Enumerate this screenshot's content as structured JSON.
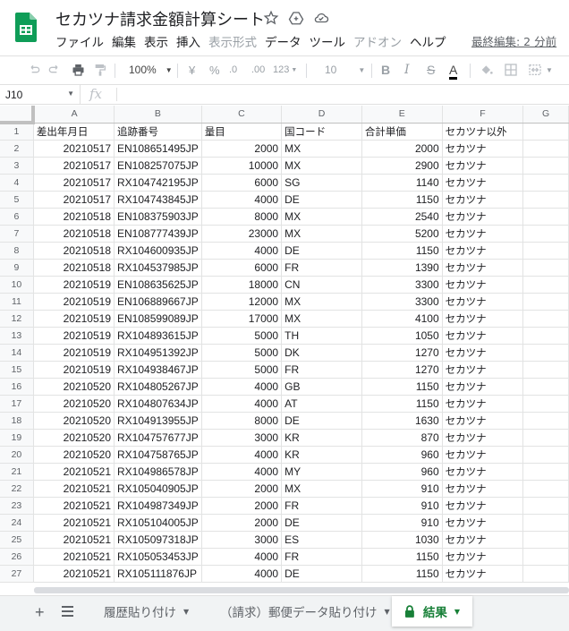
{
  "app": {
    "title": "セカツナ請求金額計算シート",
    "last_edit": "最終編集: 2 分前",
    "brand_color": "#0f9d58"
  },
  "menu": {
    "items": [
      {
        "label": "ファイル",
        "enabled": true
      },
      {
        "label": "編集",
        "enabled": true
      },
      {
        "label": "表示",
        "enabled": true
      },
      {
        "label": "挿入",
        "enabled": true
      },
      {
        "label": "表示形式",
        "enabled": false
      },
      {
        "label": "データ",
        "enabled": true
      },
      {
        "label": "ツール",
        "enabled": true
      },
      {
        "label": "アドオン",
        "enabled": false
      },
      {
        "label": "ヘルプ",
        "enabled": true
      }
    ]
  },
  "toolbar": {
    "zoom": "100%",
    "currency": "¥",
    "percent": "%",
    "dec_decrease": ".0",
    "dec_increase": ".00",
    "more_formats": "123",
    "font_size": "10",
    "bold": "B",
    "italic": "I",
    "strike": "S",
    "text_color": "A"
  },
  "formula_bar": {
    "cell_ref": "J10",
    "fx": "fx",
    "value": ""
  },
  "columns": [
    "A",
    "B",
    "C",
    "D",
    "E",
    "F",
    "G"
  ],
  "header_row": [
    "差出年月日",
    "追跡番号",
    "量目",
    "国コード",
    "合計単価",
    "セカツナ以外"
  ],
  "rows": [
    [
      "20210517",
      "EN108651495JP",
      "2000",
      "MX",
      "2000",
      "セカツナ"
    ],
    [
      "20210517",
      "EN108257075JP",
      "10000",
      "MX",
      "2900",
      "セカツナ"
    ],
    [
      "20210517",
      "RX104742195JP",
      "6000",
      "SG",
      "1140",
      "セカツナ"
    ],
    [
      "20210517",
      "RX104743845JP",
      "4000",
      "DE",
      "1150",
      "セカツナ"
    ],
    [
      "20210518",
      "EN108375903JP",
      "8000",
      "MX",
      "2540",
      "セカツナ"
    ],
    [
      "20210518",
      "EN108777439JP",
      "23000",
      "MX",
      "5200",
      "セカツナ"
    ],
    [
      "20210518",
      "RX104600935JP",
      "4000",
      "DE",
      "1150",
      "セカツナ"
    ],
    [
      "20210518",
      "RX104537985JP",
      "6000",
      "FR",
      "1390",
      "セカツナ"
    ],
    [
      "20210519",
      "EN108635625JP",
      "18000",
      "CN",
      "3300",
      "セカツナ"
    ],
    [
      "20210519",
      "EN106889667JP",
      "12000",
      "MX",
      "3300",
      "セカツナ"
    ],
    [
      "20210519",
      "EN108599089JP",
      "17000",
      "MX",
      "4100",
      "セカツナ"
    ],
    [
      "20210519",
      "RX104893615JP",
      "5000",
      "TH",
      "1050",
      "セカツナ"
    ],
    [
      "20210519",
      "RX104951392JP",
      "5000",
      "DK",
      "1270",
      "セカツナ"
    ],
    [
      "20210519",
      "RX104938467JP",
      "5000",
      "FR",
      "1270",
      "セカツナ"
    ],
    [
      "20210520",
      "RX104805267JP",
      "4000",
      "GB",
      "1150",
      "セカツナ"
    ],
    [
      "20210520",
      "RX104807634JP",
      "4000",
      "AT",
      "1150",
      "セカツナ"
    ],
    [
      "20210520",
      "RX104913955JP",
      "8000",
      "DE",
      "1630",
      "セカツナ"
    ],
    [
      "20210520",
      "RX104757677JP",
      "3000",
      "KR",
      "870",
      "セカツナ"
    ],
    [
      "20210520",
      "RX104758765JP",
      "4000",
      "KR",
      "960",
      "セカツナ"
    ],
    [
      "20210521",
      "RX104986578JP",
      "4000",
      "MY",
      "960",
      "セカツナ"
    ],
    [
      "20210521",
      "RX105040905JP",
      "2000",
      "MX",
      "910",
      "セカツナ"
    ],
    [
      "20210521",
      "RX104987349JP",
      "2000",
      "FR",
      "910",
      "セカツナ"
    ],
    [
      "20210521",
      "RX105104005JP",
      "2000",
      "DE",
      "910",
      "セカツナ"
    ],
    [
      "20210521",
      "RX105097318JP",
      "3000",
      "ES",
      "1030",
      "セカツナ"
    ],
    [
      "20210521",
      "RX105053453JP",
      "4000",
      "FR",
      "1150",
      "セカツナ"
    ],
    [
      "20210521",
      "RX105111876JP",
      "4000",
      "DE",
      "1150",
      "セカツナ"
    ]
  ],
  "sheets": [
    {
      "label": "履歴貼り付け",
      "active": false
    },
    {
      "label": "（請求）郵便データ貼り付け",
      "active": false
    },
    {
      "label": "結果",
      "active": true
    }
  ],
  "colors": {
    "active_tab": "#188038",
    "header_bg": "#f8f9fa",
    "gridline": "#e2e3e3"
  }
}
